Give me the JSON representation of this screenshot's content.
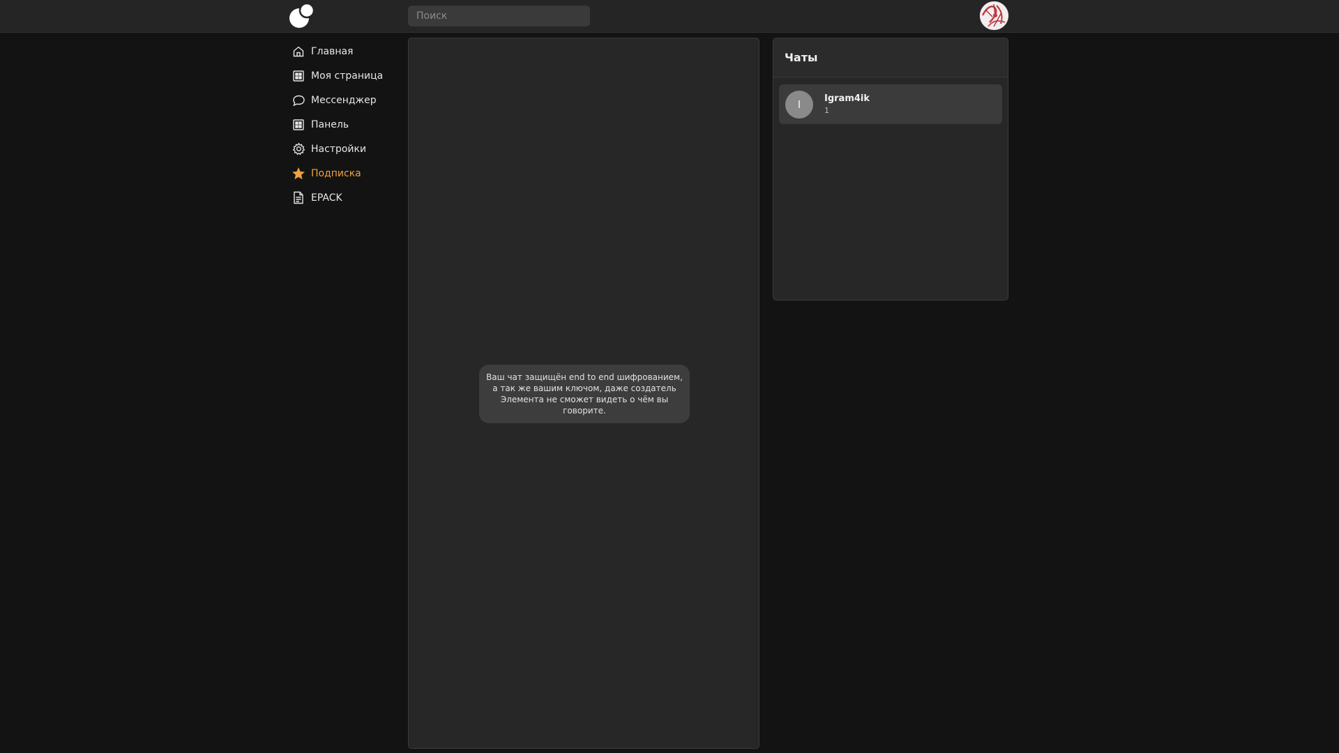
{
  "topbar": {
    "logo_icon": "bubbles-logo-icon",
    "search_placeholder": "Поиск",
    "avatar_icon": "user-avatar"
  },
  "sidebar": {
    "items": [
      {
        "label": "Главная",
        "icon": "home-icon"
      },
      {
        "label": "Моя страница",
        "icon": "grid-icon"
      },
      {
        "label": "Мессенджер",
        "icon": "chat-bubble-icon"
      },
      {
        "label": "Панель",
        "icon": "grid-icon"
      },
      {
        "label": "Настройки",
        "icon": "gear-icon"
      },
      {
        "label": "Подписка",
        "icon": "star-icon",
        "active": true,
        "color": "#f0a241"
      },
      {
        "label": "EPACK",
        "icon": "document-icon"
      }
    ]
  },
  "chat": {
    "e2e_notice": "Ваш чат защищён end to end шифрованием, а так же вашим ключом, даже создатель Элемента не сможет видеть о чём вы говорите."
  },
  "chats": {
    "title": "Чаты",
    "items": [
      {
        "avatar_letter": "I",
        "name": "Igram4ik",
        "preview": "1"
      }
    ]
  },
  "colors": {
    "accent": "#f0a241",
    "background": "#131313",
    "panel": "#272727"
  }
}
